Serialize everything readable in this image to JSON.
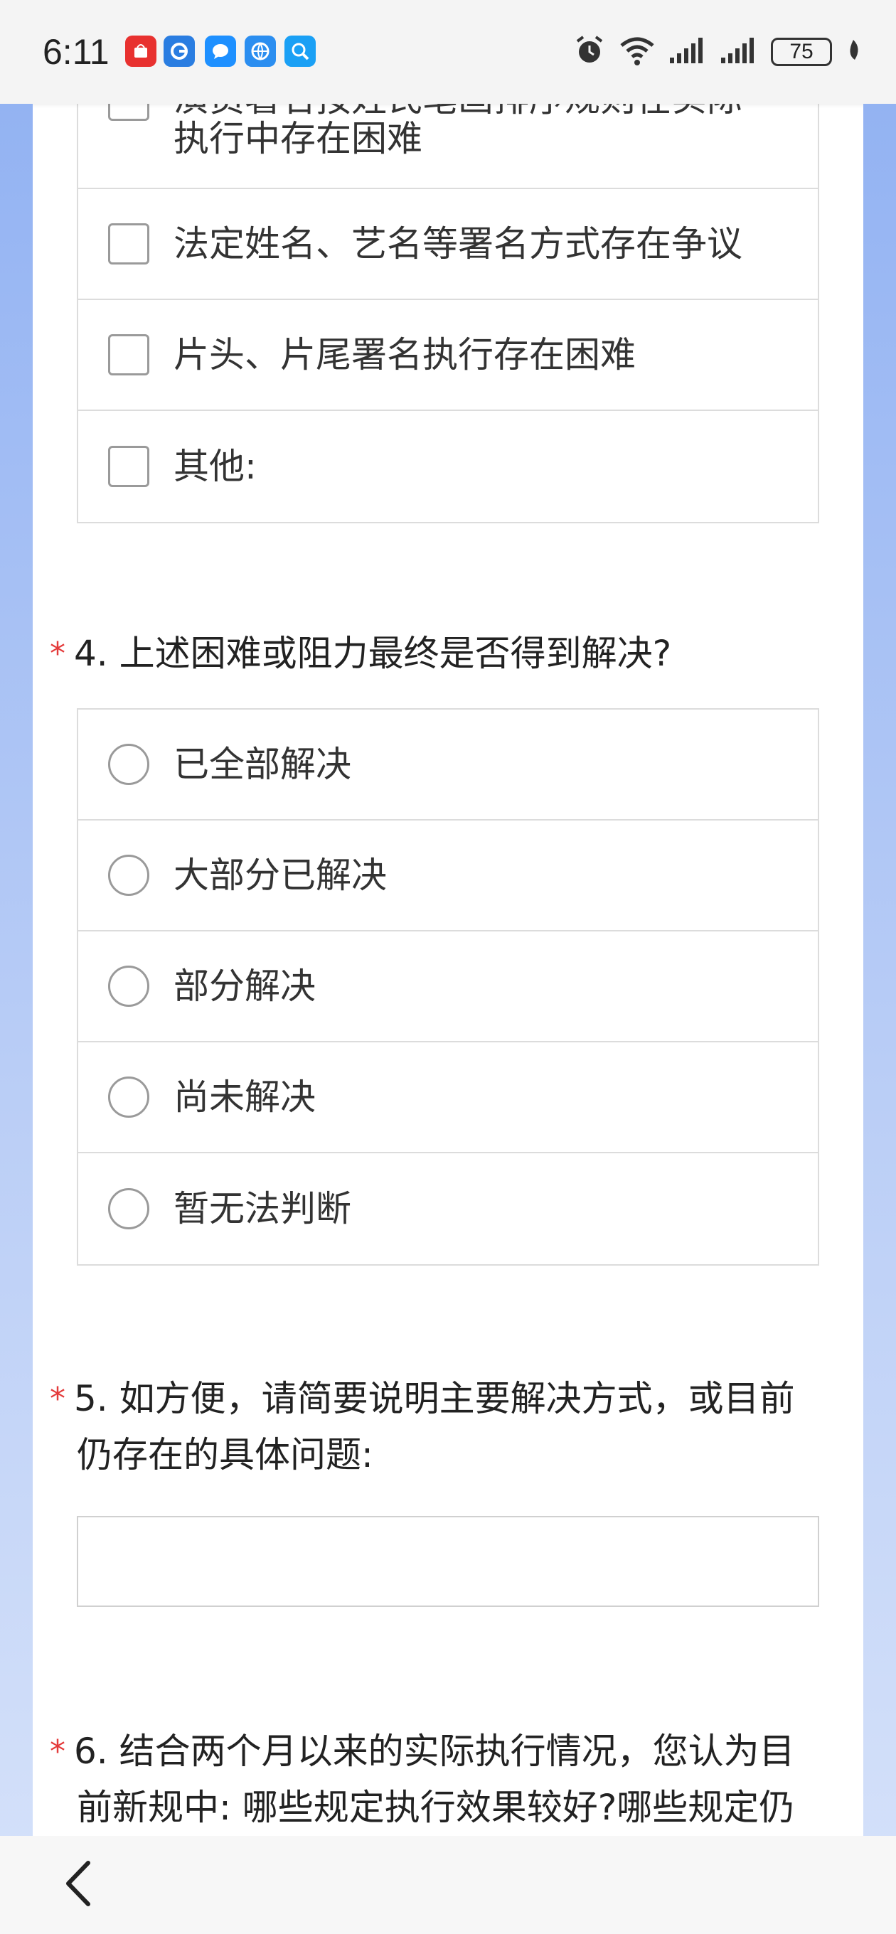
{
  "status_bar": {
    "time": "6:11",
    "app_icons": [
      {
        "name": "huawei-store-icon",
        "color": "#e8312f"
      },
      {
        "name": "guangzhou-app-icon",
        "color": "#2a7de1"
      },
      {
        "name": "messages-icon",
        "color": "#1e90ff"
      },
      {
        "name": "browser-icon",
        "color": "#2b8ef0"
      },
      {
        "name": "search-app-icon",
        "color": "#1aa0f5"
      }
    ],
    "battery": "75"
  },
  "question3": {
    "options": [
      {
        "label_line1": "演员署名按姓氏笔画排序规则在实际",
        "label_line2": "执行中存在困难"
      },
      {
        "label": "法定姓名、艺名等署名方式存在争议"
      },
      {
        "label": "片头、片尾署名执行存在困难"
      },
      {
        "label": "其他:"
      }
    ]
  },
  "question4": {
    "star": "*",
    "title": "4. 上述困难或阻力最终是否得到解决?",
    "options": [
      "已全部解决",
      "大部分已解决",
      "部分解决",
      "尚未解决",
      "暂无法判断"
    ]
  },
  "question5": {
    "star": "*",
    "title_line1": "5. 如方便，请简要说明主要解决方式，或目前",
    "title_line2": "仍存在的具体问题:",
    "value": ""
  },
  "question6": {
    "star": "*",
    "title_line1": "6. 结合两个月以来的实际执行情况，您认为目",
    "title_line2": "前新规中: 哪些规定执行效果较好?哪些规定仍"
  },
  "colors": {
    "accent_required": "#e43b3b",
    "background_gradient_top": "#8fb0f2",
    "border": "#dcdcdc"
  }
}
